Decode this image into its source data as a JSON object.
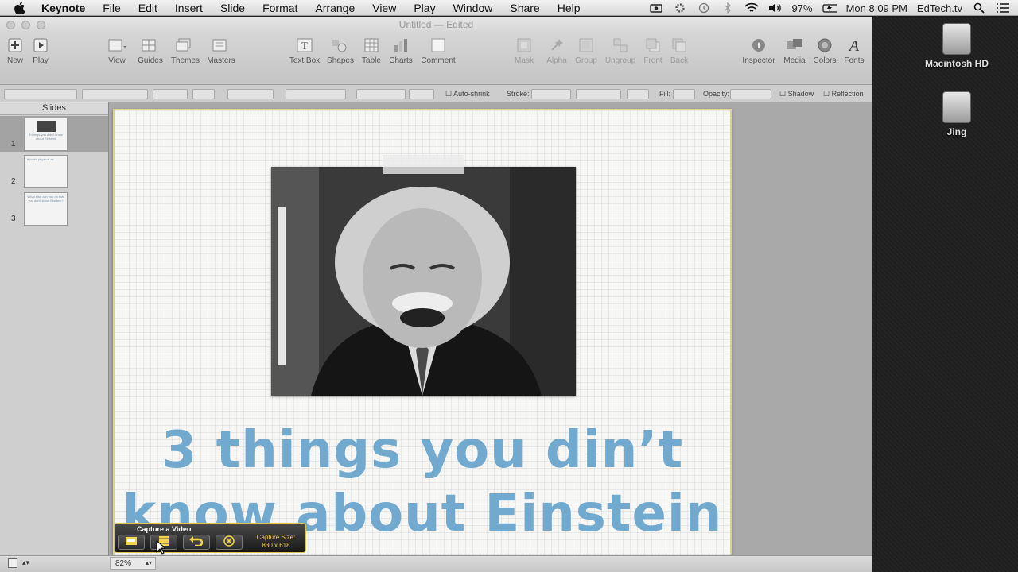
{
  "menubar": {
    "items": [
      "Keynote",
      "File",
      "Edit",
      "Insert",
      "Slide",
      "Format",
      "Arrange",
      "View",
      "Play",
      "Window",
      "Share",
      "Help"
    ],
    "battery": "97%",
    "clock": "Mon 8:09 PM",
    "user": "EdTech.tv"
  },
  "window": {
    "title": "Untitled — Edited"
  },
  "toolbar": {
    "new": "New",
    "play": "Play",
    "view": "View",
    "guides": "Guides",
    "themes": "Themes",
    "masters": "Masters",
    "textbox": "Text Box",
    "shapes": "Shapes",
    "table": "Table",
    "charts": "Charts",
    "comment": "Comment",
    "mask": "Mask",
    "alpha": "Alpha",
    "group": "Group",
    "ungroup": "Ungroup",
    "front": "Front",
    "back": "Back",
    "inspector": "Inspector",
    "media": "Media",
    "colors": "Colors",
    "fonts": "Fonts"
  },
  "formatbar": {
    "autoshrink": "Auto-shrink",
    "stroke": "Stroke:",
    "fill": "Fill:",
    "opacity": "Opacity:",
    "shadow": "Shadow",
    "reflection": "Reflection"
  },
  "sidebar": {
    "header": "Slides",
    "slides": [
      {
        "num": "1",
        "text": "3 things you didn't know about Einstein"
      },
      {
        "num": "2",
        "text": "It looks physical as ..."
      },
      {
        "num": "3",
        "text": "What else can you do that you don't know Einstein?"
      }
    ]
  },
  "slide": {
    "title_line1": "3 things you din’t",
    "title_line2": "know about Einstein"
  },
  "status": {
    "zoom": "82%"
  },
  "jing": {
    "title": "Capture a Video",
    "capture_label": "Capture Size:",
    "capture_size": "830 x 618"
  },
  "desktop": {
    "drive1": "Macintosh HD",
    "drive2": "Jing"
  },
  "colors": {
    "title_text": "#71a9cf",
    "jing_accent": "#f1d24a"
  }
}
